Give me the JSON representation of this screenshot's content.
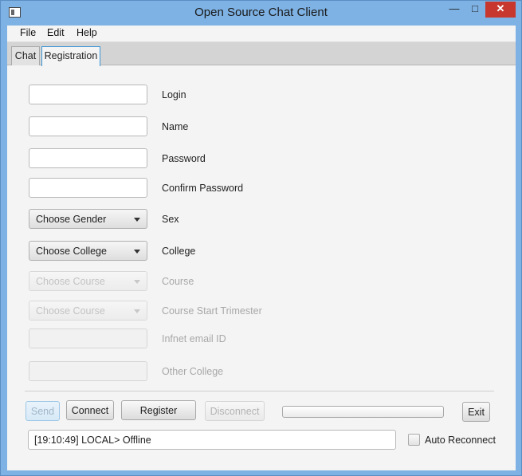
{
  "window": {
    "title": "Open Source Chat Client"
  },
  "menu": {
    "items": [
      "File",
      "Edit",
      "Help"
    ]
  },
  "tabs": [
    {
      "label": "Chat",
      "selected": false
    },
    {
      "label": "Registration",
      "selected": true
    }
  ],
  "form": {
    "login": {
      "label": "Login",
      "value": ""
    },
    "name": {
      "label": "Name",
      "value": ""
    },
    "password": {
      "label": "Password",
      "value": ""
    },
    "confirm_password": {
      "label": "Confirm Password",
      "value": ""
    },
    "sex": {
      "label": "Sex",
      "selected": "Choose Gender"
    },
    "college": {
      "label": "College",
      "selected": "Choose College"
    },
    "course": {
      "label": "Course",
      "selected": "Choose Course",
      "disabled": true
    },
    "course_start": {
      "label": "Course Start Trimester",
      "selected": "Choose Course",
      "disabled": true
    },
    "infnet_email": {
      "label": "Infnet email ID",
      "value": "",
      "disabled": true
    },
    "other_college": {
      "label": "Other College",
      "value": "",
      "disabled": true
    }
  },
  "actions": {
    "send": "Send",
    "connect": "Connect",
    "register": "Register",
    "disconnect": "Disconnect",
    "exit": "Exit"
  },
  "progress": {
    "value": 0
  },
  "status": {
    "text": "[19:10:49] LOCAL> Offline"
  },
  "auto_reconnect": {
    "label": "Auto Reconnect",
    "checked": false
  },
  "colors": {
    "titlebar": "#7eb2e4",
    "close_button": "#c7372d",
    "focus_accent": "#3c96d6"
  }
}
